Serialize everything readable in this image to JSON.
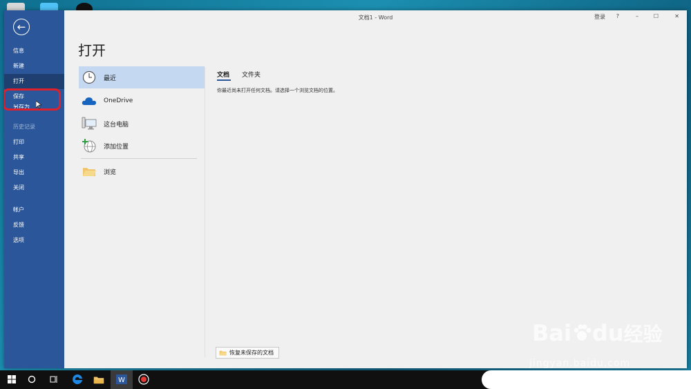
{
  "window": {
    "title": "文档1 - Word",
    "signin": "登录",
    "help": "?",
    "minimize": "–",
    "maximize": "☐",
    "close": "✕"
  },
  "nav": {
    "back": "←",
    "items": [
      {
        "label": "信息"
      },
      {
        "label": "新建"
      },
      {
        "label": "打开"
      },
      {
        "label": "保存"
      },
      {
        "label": "另存为"
      },
      {
        "label": "历史记录"
      },
      {
        "label": "打印"
      },
      {
        "label": "共享"
      },
      {
        "label": "导出"
      },
      {
        "label": "关闭"
      },
      {
        "label": "帐户"
      },
      {
        "label": "反馈"
      },
      {
        "label": "选项"
      }
    ]
  },
  "page": {
    "heading": "打开",
    "places": [
      {
        "label": "最近",
        "icon": "clock-icon"
      },
      {
        "label": "OneDrive",
        "icon": "cloud-icon"
      },
      {
        "label": "这台电脑",
        "icon": "computer-icon"
      },
      {
        "label": "添加位置",
        "icon": "globe-add-icon"
      },
      {
        "label": "浏览",
        "icon": "folder-icon"
      }
    ],
    "tabs": [
      {
        "label": "文档"
      },
      {
        "label": "文件夹"
      }
    ],
    "empty_message": "你最近尚未打开任何文档。请选择一个浏览文档的位置。",
    "recover_button": "恢复未保存的文档"
  },
  "watermark": {
    "brand": "Bai",
    "brand2": "du",
    "product": "经验",
    "url": "jingyan.baidu.com"
  },
  "colors": {
    "accent": "#2b579a",
    "highlight": "#e0202a",
    "selected_place": "#c5d8f1"
  }
}
